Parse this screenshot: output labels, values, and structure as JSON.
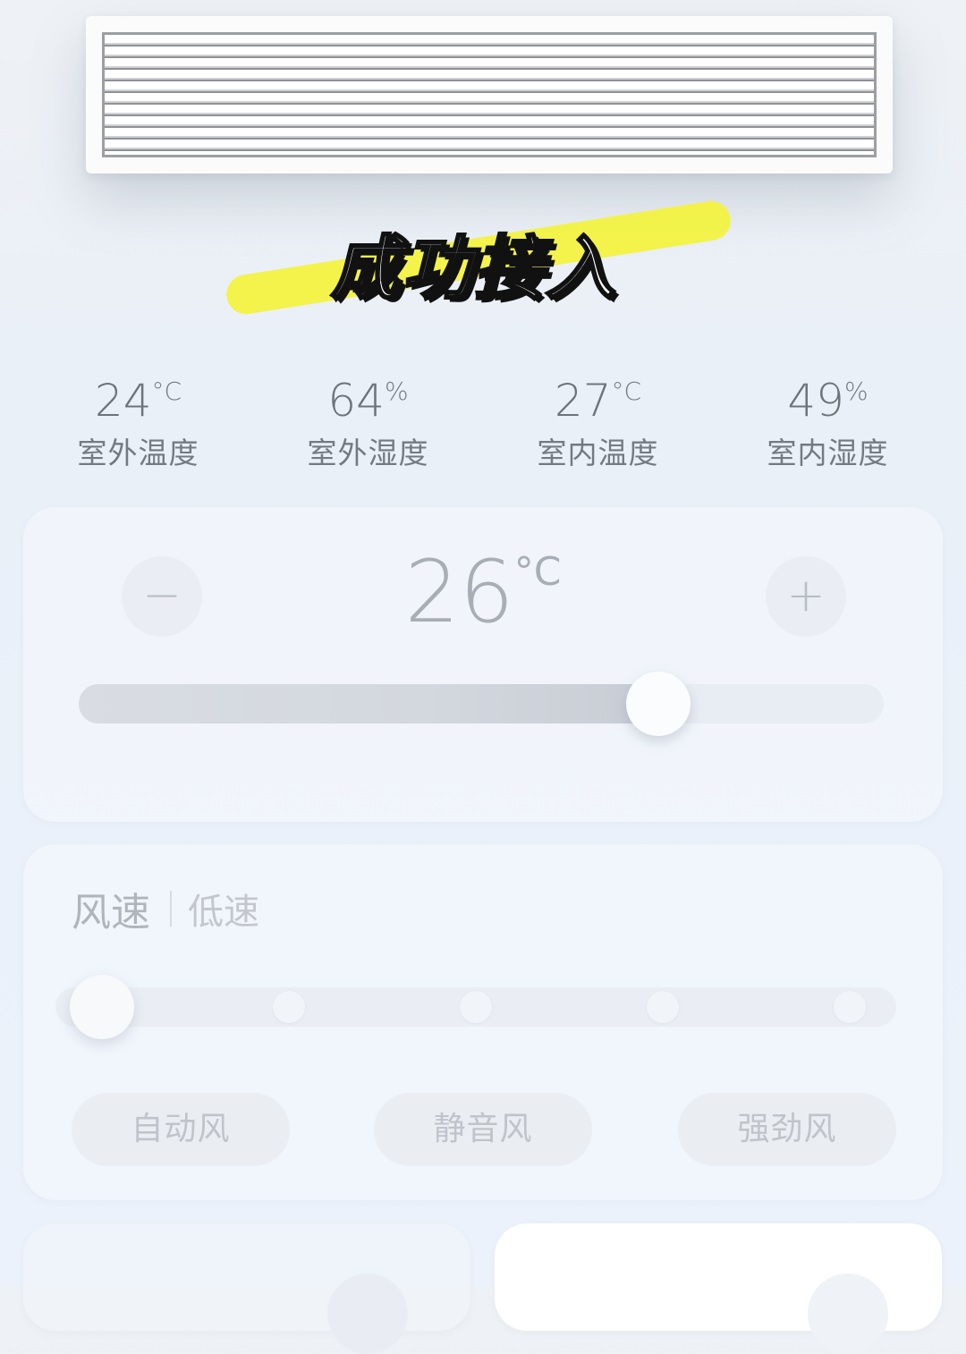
{
  "headline": "成功接入",
  "stats": [
    {
      "value": "24",
      "unit": "°C",
      "label": "室外温度"
    },
    {
      "value": "64",
      "unit": "%",
      "label": "室外湿度"
    },
    {
      "value": "27",
      "unit": "°C",
      "label": "室内温度"
    },
    {
      "value": "49",
      "unit": "%",
      "label": "室内湿度"
    }
  ],
  "temperature": {
    "setpoint": "26",
    "unit": "°C",
    "minus_label": "−",
    "plus_label": "+",
    "slider_fraction": 0.72
  },
  "fan": {
    "title": "风速",
    "value": "低速",
    "levels": 5,
    "selected_level": 0,
    "modes": [
      "自动风",
      "静音风",
      "强劲风"
    ]
  },
  "colors": {
    "highlight": "#f3f33c",
    "background": "#eaf0f8"
  }
}
